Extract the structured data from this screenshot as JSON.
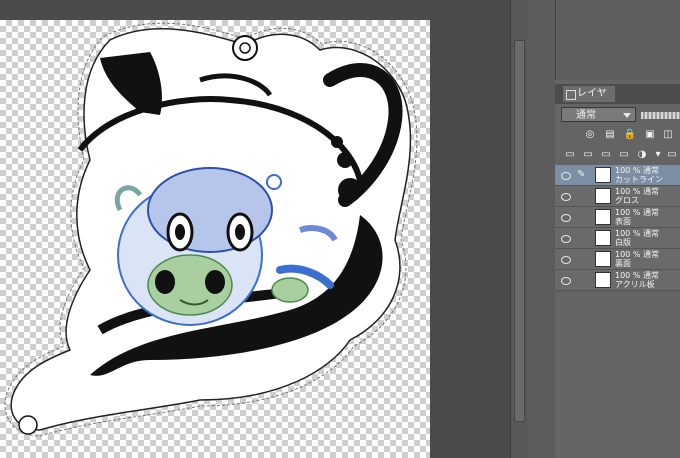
{
  "layer_panel": {
    "tab_label": "レイヤー",
    "blend_mode": "通常"
  },
  "layers": [
    {
      "opacity": "100 % 通常",
      "name": "カットライン",
      "selected": true,
      "locked_pen": true
    },
    {
      "opacity": "100 % 通常",
      "name": "グロス"
    },
    {
      "opacity": "100 % 通常",
      "name": "表面"
    },
    {
      "opacity": "100 % 通常",
      "name": "白版"
    },
    {
      "opacity": "100 % 通常",
      "name": "裏面"
    },
    {
      "opacity": "100 % 通常",
      "name": "アクリル板"
    }
  ],
  "icons": {
    "eye": "eye-icon",
    "pen": "pen-icon",
    "tab": "layer-tab-icon"
  },
  "colors": {
    "panel_bg": "#646464",
    "selected_layer": "#7b8ea3",
    "canvas_bg": "#4b4b4b"
  }
}
